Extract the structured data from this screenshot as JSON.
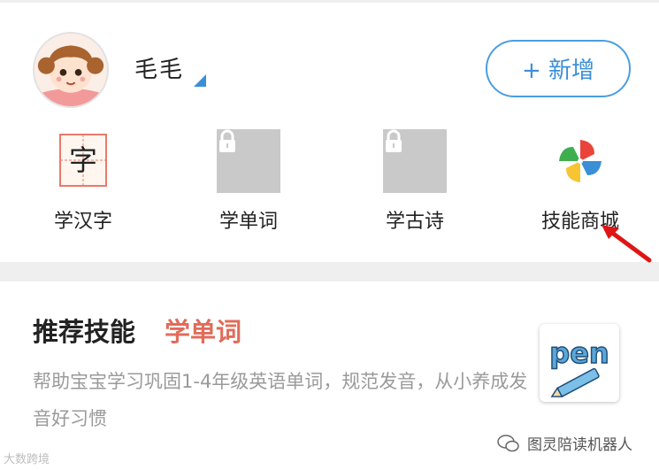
{
  "profile": {
    "name": "毛毛",
    "add_button": "+ 新增"
  },
  "skills": [
    {
      "label": "学汉字",
      "icon": "hanzi-card-icon",
      "locked": false
    },
    {
      "label": "学单词",
      "icon": "lock-icon",
      "locked": true
    },
    {
      "label": "学古诗",
      "icon": "lock-icon",
      "locked": true
    },
    {
      "label": "技能商城",
      "icon": "pinwheel-icon",
      "locked": false
    }
  ],
  "hanzi_char": "字",
  "recommend": {
    "title": "推荐技能",
    "skill": "学单词",
    "description": "帮助宝宝学习巩固1-4年级英语单词，规范发音，从小养成发音好习惯",
    "image_text": "pen"
  },
  "watermarks": {
    "left": "大数跨境",
    "right": "图灵陪读机器人"
  },
  "colors": {
    "accent_blue": "#3b8fd6",
    "recommend_red": "#e06c5a",
    "arrow_red": "#e01515"
  }
}
